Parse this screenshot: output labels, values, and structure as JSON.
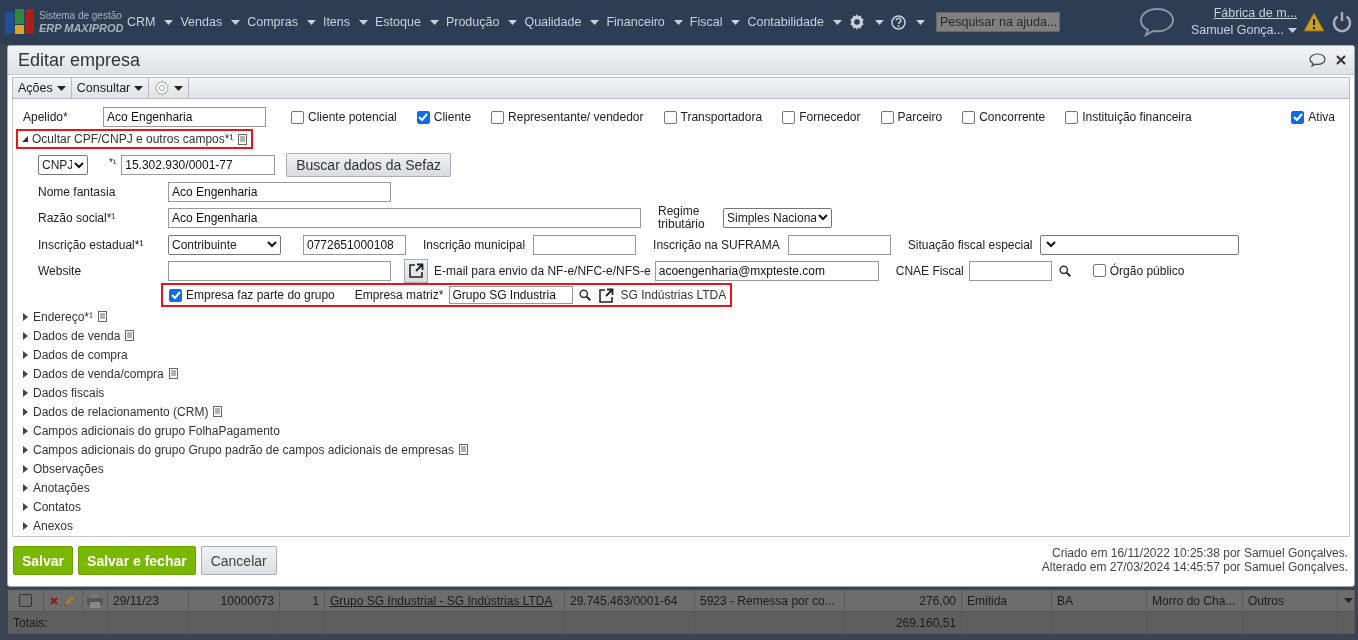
{
  "top_bar": {
    "logo": {
      "line1": "Sistema de gestão",
      "line2": "ERP MAXIPROD"
    },
    "menus": [
      "CRM",
      "Vendas",
      "Compras",
      "Itens",
      "Estoque",
      "Produção",
      "Qualidade",
      "Financeiro",
      "Fiscal",
      "Contabilidade"
    ],
    "search": {
      "placeholder": "Pesquisar na ajuda..."
    },
    "company": "Fábrica de m...",
    "user": "Samuel Gonça..."
  },
  "dialog": {
    "title": "Editar empresa",
    "toolbar": [
      "Ações",
      "Consultar"
    ],
    "apelido": {
      "label": "Apelido*",
      "value": "Aco Engenharia"
    },
    "roles": [
      {
        "label": "Cliente potencial",
        "checked": false
      },
      {
        "label": "Cliente",
        "checked": true
      },
      {
        "label": "Representante/ vendedor",
        "checked": false
      },
      {
        "label": "Transportadora",
        "checked": false
      },
      {
        "label": "Fornecedor",
        "checked": false
      },
      {
        "label": "Parceiro",
        "checked": false
      },
      {
        "label": "Concorrente",
        "checked": false
      },
      {
        "label": "Instituição financeira",
        "checked": false
      }
    ],
    "ativa": {
      "label": "Ativa",
      "checked": true
    },
    "toggle": {
      "label": "Ocultar CPF/CNPJ e outros campos*¹",
      "expanded": true,
      "highlighted": true
    },
    "form_rows": [
      {
        "highlighted": false,
        "items": [
          {
            "kind": "select",
            "value": "CNPJ"
          },
          {
            "kind": "label",
            "label": "*¹"
          },
          {
            "kind": "input",
            "value": "15.302.930/0001-77"
          },
          {
            "kind": "button",
            "label": "Buscar dados da Sefaz"
          }
        ]
      },
      {
        "highlighted": false,
        "items": [
          {
            "kind": "label",
            "label": "Nome fantasia"
          },
          {
            "kind": "input",
            "value": "Aco Engenharia"
          }
        ]
      },
      {
        "highlighted": false,
        "items": [
          {
            "kind": "label",
            "label": "Razão social*¹"
          },
          {
            "kind": "input",
            "value": "Aco Engenharia"
          },
          {
            "kind": "label",
            "label": "Regime tributário"
          },
          {
            "kind": "select",
            "value": "Simples Naciona"
          }
        ]
      },
      {
        "highlighted": false,
        "items": [
          {
            "kind": "label",
            "label": "Inscrição estadual*¹"
          },
          {
            "kind": "select",
            "value": "Contribuinte"
          },
          {
            "kind": "input",
            "value": "0772651000108"
          },
          {
            "kind": "label",
            "label": "Inscrição municipal"
          },
          {
            "kind": "input"
          },
          {
            "kind": "label",
            "label": "Inscrição na SUFRAMA"
          },
          {
            "kind": "input"
          },
          {
            "kind": "label",
            "label": "Situação fiscal especial"
          },
          {
            "kind": "select"
          }
        ]
      },
      {
        "highlighted": false,
        "items": [
          {
            "kind": "label",
            "label": "Website"
          },
          {
            "kind": "input"
          },
          {
            "kind": "popout"
          },
          {
            "kind": "label",
            "label": "E-mail para envio da NF-e/NFC-e/NFS-e"
          },
          {
            "kind": "input",
            "value": "acoengenharia@mxpteste.com"
          },
          {
            "kind": "label",
            "label": "CNAE Fiscal"
          },
          {
            "kind": "input"
          },
          {
            "kind": "search"
          },
          {
            "kind": "checkbox",
            "label": "Órgão público",
            "checked": false
          }
        ]
      },
      {
        "highlighted": true,
        "items": [
          {
            "kind": "checkbox",
            "label": "Empresa faz parte do grupo",
            "checked": true
          },
          {
            "kind": "label",
            "label": "Empresa matriz*"
          },
          {
            "kind": "input",
            "value": "Grupo SG Industria"
          },
          {
            "kind": "search"
          },
          {
            "kind": "popout"
          },
          {
            "kind": "link",
            "label": "SG Indústrias LTDA"
          }
        ]
      }
    ],
    "sections": [
      {
        "label": "Endereço*¹",
        "note": true,
        "expanded": false
      },
      {
        "label": "Dados de venda",
        "note": true,
        "expanded": false
      },
      {
        "label": "Dados de compra",
        "note": false,
        "expanded": false
      },
      {
        "label": "Dados de venda/compra",
        "note": true,
        "expanded": false
      },
      {
        "label": "Dados fiscais",
        "note": false,
        "expanded": false
      },
      {
        "label": "Dados de relacionamento (CRM)",
        "note": true,
        "expanded": false
      },
      {
        "label": "Campos adicionais do grupo FolhaPagamento",
        "note": false,
        "expanded": false
      },
      {
        "label": "Campos adicionais do grupo Grupo padrão de campos adicionais de empresas",
        "note": true,
        "expanded": false
      },
      {
        "label": "Observações",
        "note": false,
        "expanded": false
      },
      {
        "label": "Anotações",
        "note": false,
        "expanded": false
      },
      {
        "label": "Contatos",
        "note": false,
        "expanded": false
      },
      {
        "label": "Anexos",
        "note": false,
        "expanded": false
      }
    ],
    "buttons": [
      {
        "label": "Salvar",
        "kind": "primary"
      },
      {
        "label": "Salvar e fechar",
        "kind": "primary"
      },
      {
        "label": "Cancelar",
        "kind": "secondary"
      }
    ],
    "audit": [
      "Criado em 16/11/2022 10:25:38 por Samuel Gonçalves.",
      "Alterado em 27/03/2024 14:45:57 por Samuel Gonçalves."
    ]
  },
  "grid": {
    "row": {
      "checked": false,
      "date": "29/11/23",
      "number": "10000073",
      "seq": "1",
      "customer": "Grupo SG Industrial - SG Indústrias LTDA",
      "cnpj": "29.745.463/0001-64",
      "cfop": "5923 - Remessa por co...",
      "value": "276,00",
      "status": "Emitida",
      "uf": "BA",
      "city": "Morro do Cha...",
      "category": "Outros"
    },
    "totals": {
      "label": "Totais:",
      "value": "269.160,51"
    }
  }
}
